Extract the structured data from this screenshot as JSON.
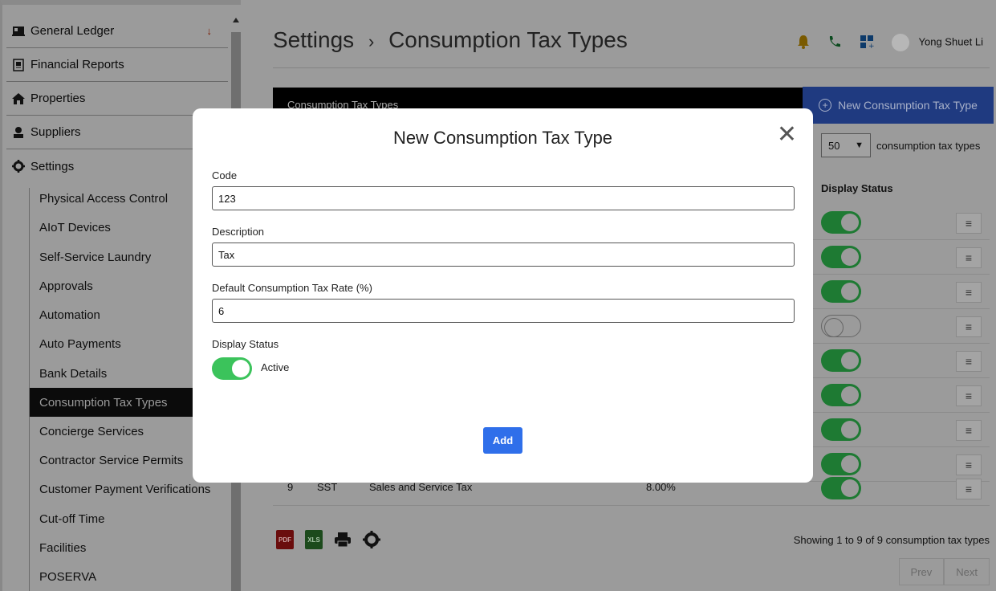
{
  "sidebar": {
    "top_items": [
      {
        "label": "General Ledger",
        "icon": "ledger-icon"
      },
      {
        "label": "Financial Reports",
        "icon": "report-icon"
      },
      {
        "label": "Properties",
        "icon": "home-icon"
      },
      {
        "label": "Suppliers",
        "icon": "supplier-icon"
      },
      {
        "label": "Settings",
        "icon": "gear-icon"
      }
    ],
    "sub_items": [
      {
        "label": "Physical Access Control"
      },
      {
        "label": "AIoT Devices"
      },
      {
        "label": "Self-Service Laundry"
      },
      {
        "label": "Approvals"
      },
      {
        "label": "Automation"
      },
      {
        "label": "Auto Payments"
      },
      {
        "label": "Bank Details"
      },
      {
        "label": "Consumption Tax Types"
      },
      {
        "label": "Concierge Services"
      },
      {
        "label": "Contractor Service Permits"
      },
      {
        "label": "Customer Payment Verifications"
      },
      {
        "label": "Cut-off Time"
      },
      {
        "label": "Facilities"
      },
      {
        "label": "POSERVA"
      }
    ],
    "general_ledger_indicator": "↓"
  },
  "header": {
    "breadcrumb_root": "Settings",
    "breadcrumb_sep": "›",
    "breadcrumb_page": "Consumption Tax Types",
    "user_name": "Yong Shuet Li"
  },
  "table": {
    "header_label": "Consumption Tax Types",
    "new_button_label": "New Consumption Tax Type",
    "page_size": "50",
    "page_size_suffix": "consumption tax types",
    "status_column": "Display Status",
    "rows": [
      {
        "active": true
      },
      {
        "active": true
      },
      {
        "active": true
      },
      {
        "active": false
      },
      {
        "active": true
      },
      {
        "active": true
      },
      {
        "active": true
      },
      {
        "active": true
      },
      {
        "active": true,
        "no": "9",
        "code": "SST",
        "description": "Sales and Service Tax",
        "rate": "8.00%"
      }
    ],
    "showing_text": "Showing 1 to 9 of 9 consumption tax types",
    "prev_label": "Prev",
    "next_label": "Next",
    "export_icons": [
      "pdf-icon",
      "xls-icon",
      "print-icon",
      "settings-icon"
    ]
  },
  "modal": {
    "title": "New Consumption Tax Type",
    "close_glyph": "✕",
    "code_label": "Code",
    "code_value": "123",
    "description_label": "Description",
    "description_value": "Tax",
    "rate_label": "Default Consumption Tax Rate (%)",
    "rate_value": "6",
    "status_label": "Display Status",
    "status_value": "Active",
    "add_label": "Add"
  },
  "colors": {
    "primary_button": "#2f6fea",
    "toggle_on": "#3bc35b",
    "overlay": "#9b9b9b"
  }
}
